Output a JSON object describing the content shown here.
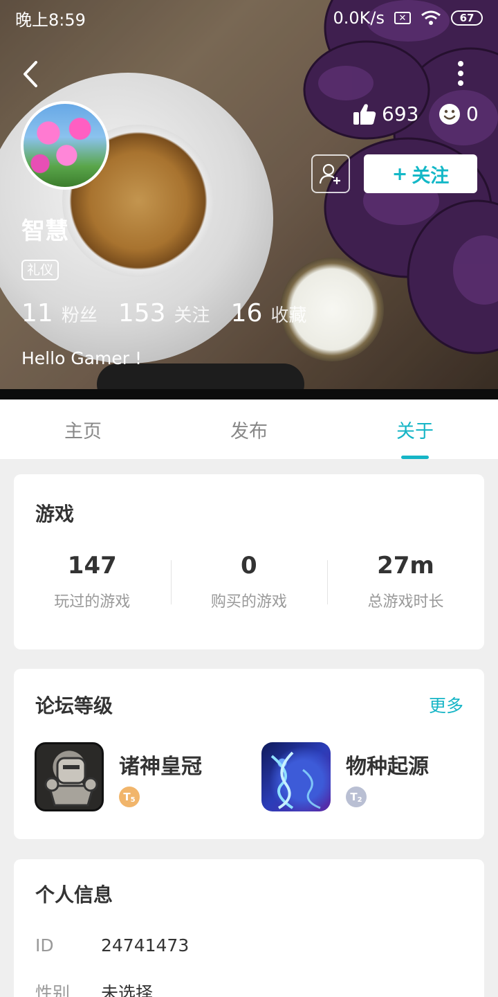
{
  "status_bar": {
    "time": "晚上8:59",
    "network_speed": "0.0K/s",
    "battery": "67"
  },
  "profile": {
    "likes": "693",
    "smiles": "0",
    "follow_label": "关注",
    "username": "智慧",
    "badge": "礼仪",
    "counts": [
      {
        "value": "11",
        "label": "粉丝"
      },
      {
        "value": "153",
        "label": "关注"
      },
      {
        "value": "16",
        "label": "收藏"
      }
    ],
    "bio": "Hello Gamer !"
  },
  "tabs": [
    {
      "label": "主页",
      "active": false
    },
    {
      "label": "发布",
      "active": false
    },
    {
      "label": "关于",
      "active": true
    }
  ],
  "games_card": {
    "title": "游戏",
    "stats": [
      {
        "value": "147",
        "label": "玩过的游戏"
      },
      {
        "value": "0",
        "label": "购买的游戏"
      },
      {
        "value": "27m",
        "label": "总游戏时长"
      }
    ]
  },
  "forum_card": {
    "title": "论坛等级",
    "more": "更多",
    "items": [
      {
        "name": "诸神皇冠",
        "level": "5",
        "level_color": "#f1b56b"
      },
      {
        "name": "物种起源",
        "level": "2",
        "level_color": "#b9bfd3"
      }
    ]
  },
  "info_card": {
    "title": "个人信息",
    "rows": [
      {
        "key": "ID",
        "value": "24741473"
      },
      {
        "key": "性别",
        "value": "未选择"
      }
    ]
  },
  "colors": {
    "accent": "#16b5c6"
  }
}
